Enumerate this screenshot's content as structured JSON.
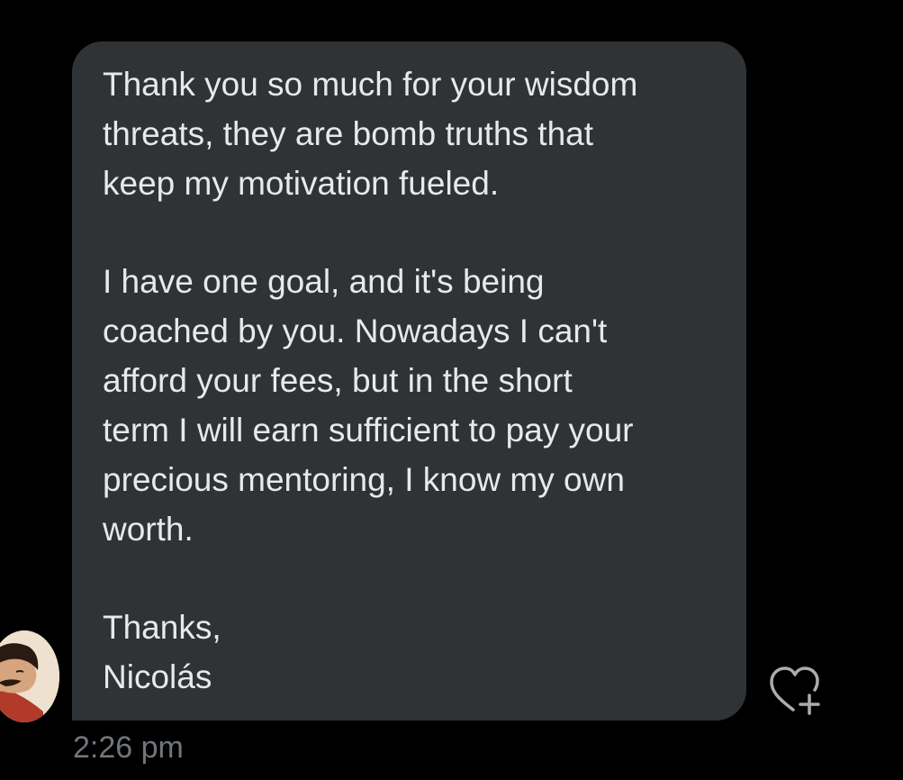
{
  "message": {
    "paragraph_1": [
      "Thank you so much for your wisdom",
      "threats, they are bomb truths that",
      "keep my motivation fueled."
    ],
    "paragraph_2": [
      "I have one goal, and it's being",
      "coached by you. Nowadays I can't",
      "afford your fees, but in the short",
      "term I will earn sufficient to pay your",
      "precious mentoring, I know my own",
      "worth."
    ],
    "paragraph_3": [
      "Thanks,",
      "Nicolás"
    ],
    "timestamp": "2:26 pm"
  },
  "icons": {
    "avatar": "sender-avatar",
    "reaction": "heart-plus-icon"
  },
  "colors": {
    "background": "#000000",
    "bubble": "#2f3336",
    "text": "#e7e9ea",
    "muted": "#71767b"
  }
}
